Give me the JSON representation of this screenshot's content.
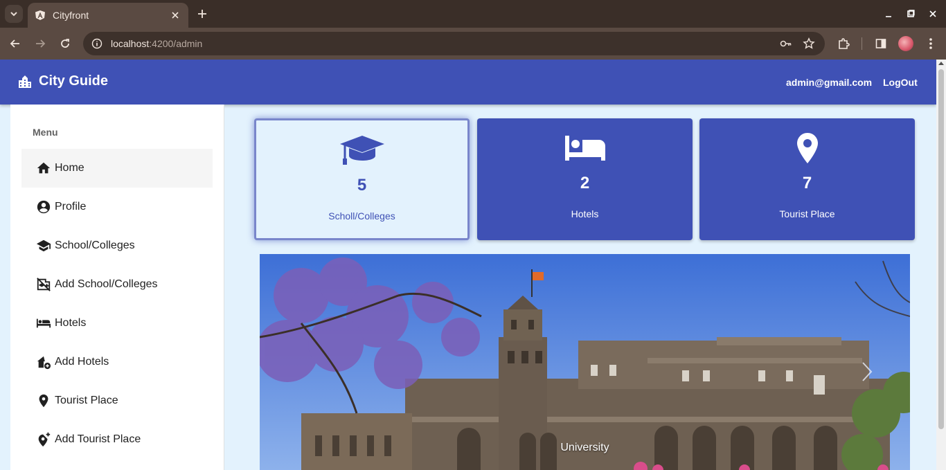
{
  "browser": {
    "tab_title": "Cityfront",
    "url_host": "localhost",
    "url_path": ":4200/admin"
  },
  "app": {
    "brand_title": "City Guide",
    "user_email": "admin@gmail.com",
    "logout_label": "LogOut"
  },
  "sidebar": {
    "header": "Menu",
    "items": [
      {
        "label": "Home",
        "icon": "home-icon",
        "active": true
      },
      {
        "label": "Profile",
        "icon": "account-circle-icon"
      },
      {
        "label": "School/Colleges",
        "icon": "school-icon"
      },
      {
        "label": "Add School/Colleges",
        "icon": "add-school-icon"
      },
      {
        "label": "Hotels",
        "icon": "hotel-icon"
      },
      {
        "label": "Add Hotels",
        "icon": "add-hotel-icon"
      },
      {
        "label": "Tourist Place",
        "icon": "place-icon"
      },
      {
        "label": "Add Tourist Place",
        "icon": "add-place-icon"
      }
    ]
  },
  "cards": [
    {
      "count": "5",
      "label": "Scholl/Colleges",
      "icon": "graduation-cap-icon",
      "selected": true
    },
    {
      "count": "2",
      "label": "Hotels",
      "icon": "bed-icon"
    },
    {
      "count": "7",
      "label": "Tourist Place",
      "icon": "location-pin-icon"
    }
  ],
  "carousel": {
    "caption": "University"
  },
  "colors": {
    "primary": "#3f51b5",
    "background": "#e3f2fd"
  }
}
